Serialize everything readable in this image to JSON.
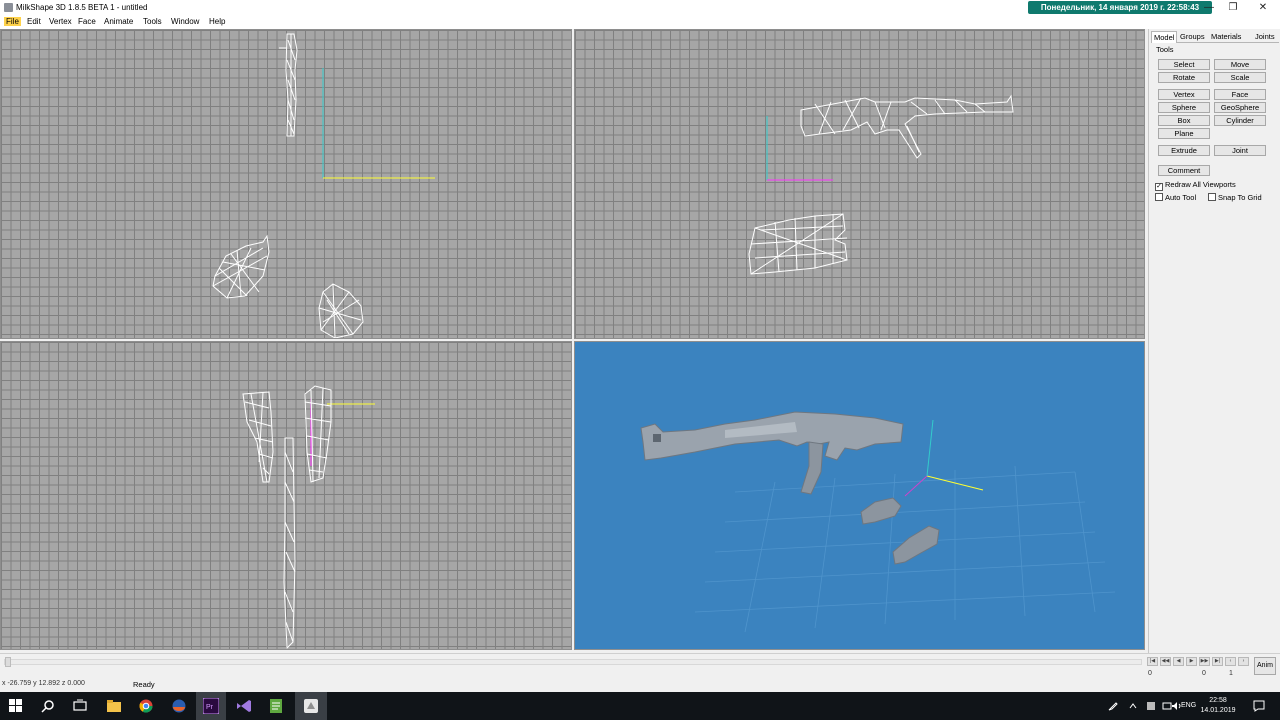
{
  "window": {
    "title": "MilkShape 3D 1.8.5 BETA 1 - untitled",
    "clock_badge": "Понедельник, 14 января 2019 г. 22:58:43",
    "minimize_glyph": "—",
    "restore_glyph": "❐",
    "close_glyph": "✕"
  },
  "menu": [
    "File",
    "Edit",
    "Vertex",
    "Face",
    "Animate",
    "Tools",
    "Window",
    "Help"
  ],
  "panel": {
    "tabs": [
      "Model",
      "Groups",
      "Materials",
      "Joints"
    ],
    "active_tab": "Model",
    "tools_label": "Tools",
    "buttons": {
      "select": "Select",
      "move": "Move",
      "rotate": "Rotate",
      "scale": "Scale",
      "vertex": "Vertex",
      "face": "Face",
      "sphere": "Sphere",
      "geosphere": "GeoSphere",
      "box": "Box",
      "cylinder": "Cylinder",
      "plane": "Plane",
      "extrude": "Extrude",
      "joint": "Joint",
      "comment": "Comment"
    },
    "checks": {
      "redraw": {
        "label": "Redraw All Viewports",
        "checked": true
      },
      "auto_tool": {
        "label": "Auto Tool",
        "checked": false
      },
      "snap_grid": {
        "label": "Snap To Grid",
        "checked": false
      }
    },
    "check_mark": "✓"
  },
  "timeline": {
    "ticks": [
      "0",
      "0",
      "1"
    ],
    "anim_label": "Anim",
    "nav_glyphs": [
      "|◀",
      "◀◀",
      "◀",
      "▶",
      "▶▶",
      "▶|",
      "‹",
      "›",
      "«",
      "»"
    ]
  },
  "status": {
    "coords": "x -26.759 y 12.892 z 0.000",
    "text": "Ready"
  },
  "taskbar": {
    "lang": "ENG",
    "time": "22:58",
    "date": "14.01.2019"
  },
  "colors": {
    "ortho_bg": "#a6a6a6",
    "persp_bg": "#3b83bf",
    "wire": "#ffffff",
    "axis_x": "#ffff33",
    "axis_y": "#33cccc",
    "axis_z": "#ff33ff",
    "clock_bg": "#0f7a6e"
  },
  "icons": [
    "app-icon",
    "windows-start-icon",
    "search-icon",
    "task-view-icon",
    "file-explorer-icon",
    "chrome-icon",
    "browser-icon",
    "premiere-icon",
    "visual-studio-icon",
    "notepad-icon",
    "milkshape-icon",
    "network-icon",
    "volume-icon",
    "notification-icon"
  ]
}
